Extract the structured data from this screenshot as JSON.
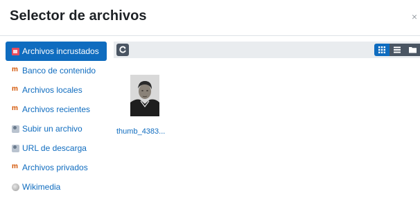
{
  "dialog": {
    "title": "Selector de archivos",
    "close_glyph": "×"
  },
  "sidebar": {
    "items": [
      {
        "label": "Archivos incrustados",
        "icon": "embedded-files-icon",
        "active": true
      },
      {
        "label": "Banco de contenido",
        "icon": "repository-icon"
      },
      {
        "label": "Archivos locales",
        "icon": "repository-icon"
      },
      {
        "label": "Archivos recientes",
        "icon": "repository-icon"
      },
      {
        "label": "Subir un archivo",
        "icon": "upload-icon"
      },
      {
        "label": "URL de descarga",
        "icon": "url-download-icon"
      },
      {
        "label": "Archivos privados",
        "icon": "repository-icon"
      },
      {
        "label": "Wikimedia",
        "icon": "wikimedia-icon"
      }
    ]
  },
  "toolbar": {
    "refresh_icon": "refresh-icon",
    "views": [
      "icons-view-icon",
      "list-view-icon",
      "folder-view-icon"
    ],
    "active_view": "icons-view-icon"
  },
  "files": [
    {
      "name": "thumb_4383...",
      "icon": "portrait-thumbnail"
    }
  ],
  "colors": {
    "accent": "#0f6cbf",
    "button_dark": "#4a5563",
    "toolbar_bg": "#e9ecef"
  }
}
